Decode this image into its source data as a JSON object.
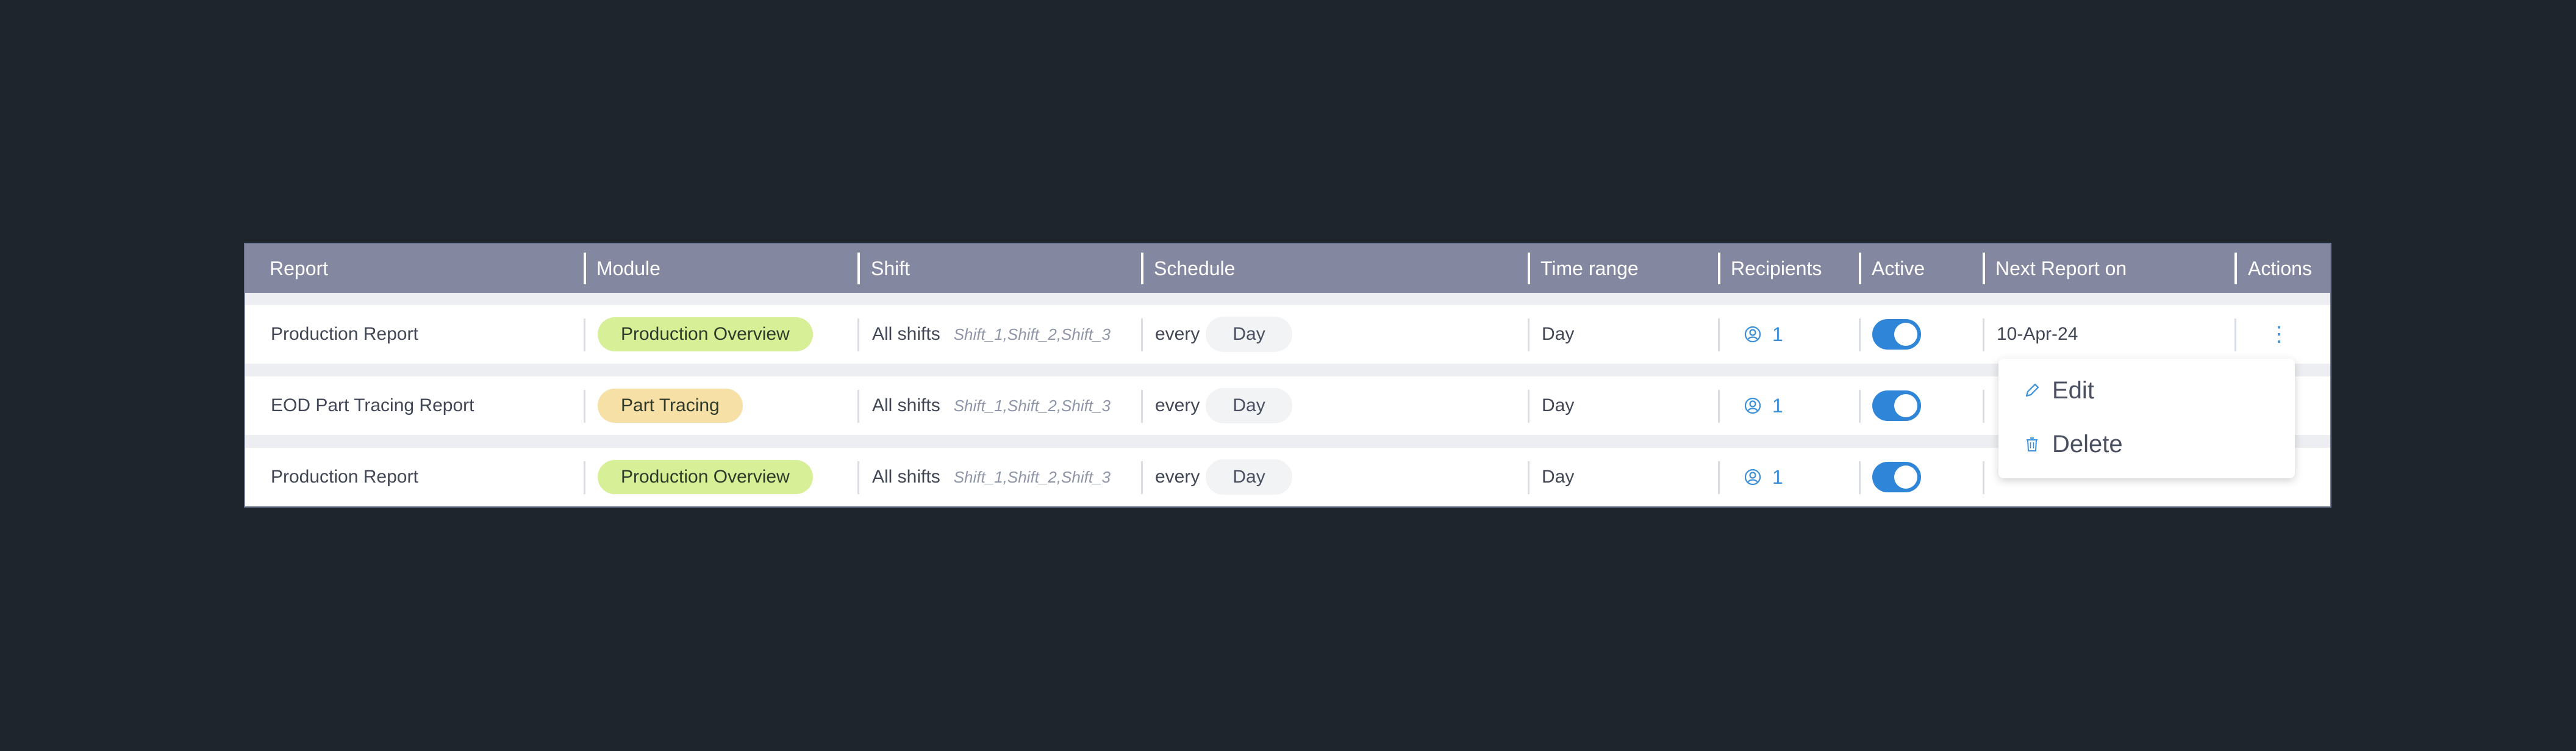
{
  "table": {
    "headers": [
      "Report",
      "Module",
      "Shift",
      "Schedule",
      "Time range",
      "Recipients",
      "Active",
      "Next Report on",
      "Actions"
    ],
    "rows": [
      {
        "report": "Production Report",
        "module": "Production Overview",
        "module_color": "#d7ef97",
        "shift": "All shifts",
        "shift_detail": "Shift_1,Shift_2,Shift_3",
        "schedule_every": "every",
        "schedule_unit": "Day",
        "time_range": "Day",
        "recipients": "1",
        "active": true,
        "next_report": "10-Apr-24"
      },
      {
        "report": "EOD Part Tracing Report",
        "module": "Part Tracing",
        "module_color": "#f7e0a6",
        "shift": "All shifts",
        "shift_detail": "Shift_1,Shift_2,Shift_3",
        "schedule_every": "every",
        "schedule_unit": "Day",
        "time_range": "Day",
        "recipients": "1",
        "active": true,
        "next_report": ""
      },
      {
        "report": "Production Report",
        "module": "Production Overview",
        "module_color": "#d7ef97",
        "shift": "All shifts",
        "shift_detail": "Shift_1,Shift_2,Shift_3",
        "schedule_every": "every",
        "schedule_unit": "Day",
        "time_range": "Day",
        "recipients": "1",
        "active": true,
        "next_report": ""
      }
    ]
  },
  "context_menu": {
    "edit_label": "Edit",
    "delete_label": "Delete"
  },
  "colors": {
    "background": "#1f252d",
    "header": "#8487a0",
    "accent": "#2f86d8"
  }
}
